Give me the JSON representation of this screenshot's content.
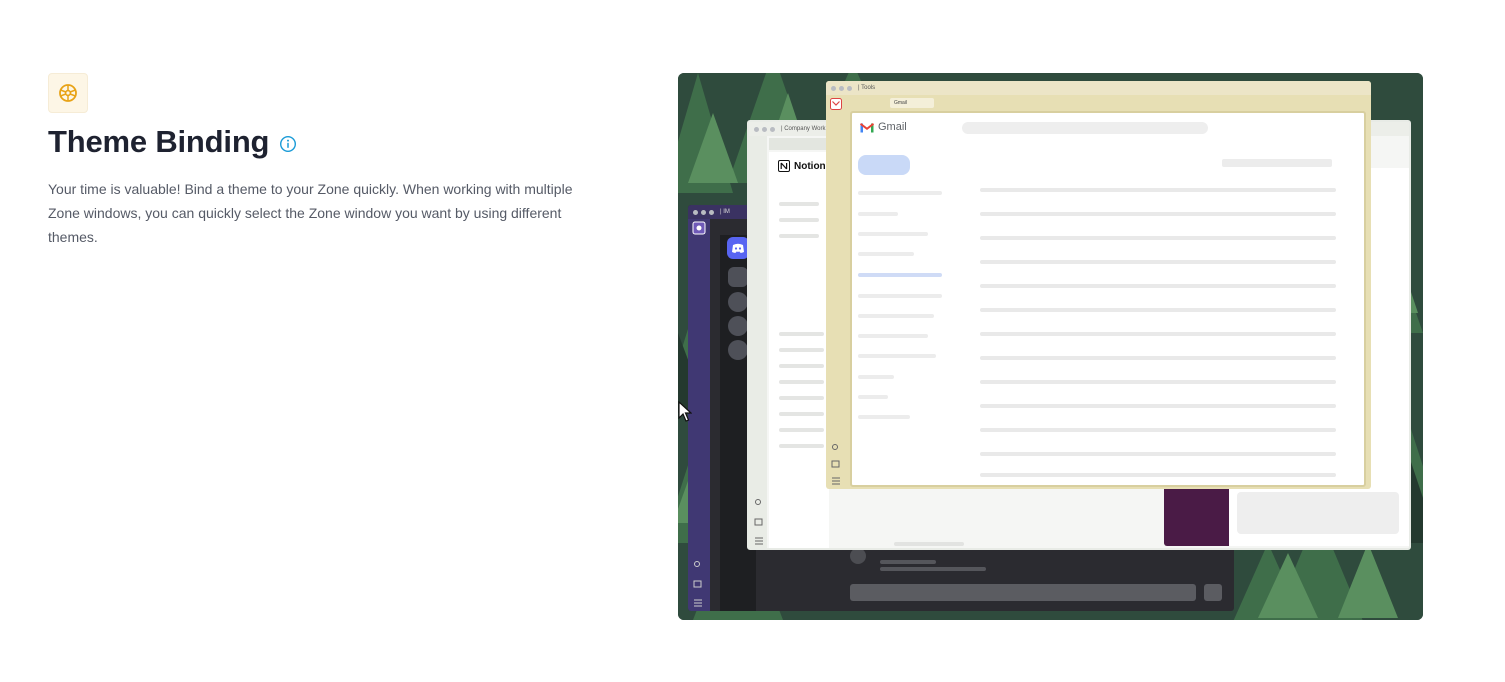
{
  "feature": {
    "icon": "theme-wheel-icon",
    "title": "Theme Binding",
    "info_icon": "info-icon",
    "description": "Your time is valuable! Bind a theme to your Zone quickly. When working with multiple Zone windows, you can quickly select the Zone window you want by using different themes."
  },
  "preview": {
    "windows": {
      "im": {
        "title": "IM"
      },
      "company_work": {
        "title": "Company Work",
        "app_label": "Notion"
      },
      "tools": {
        "title": "Tools",
        "tab_label": "Gmail",
        "app_label": "Gmail"
      }
    }
  },
  "colors": {
    "accent_icon": "#e8a317",
    "info_blue": "#1a9bd7",
    "title": "#1e2230",
    "body_text": "#555a66",
    "im_theme": "#403873",
    "company_work_theme": "#f5f6f4",
    "tools_theme": "#e7dfb4",
    "slack_purple": "#4a1b46"
  }
}
